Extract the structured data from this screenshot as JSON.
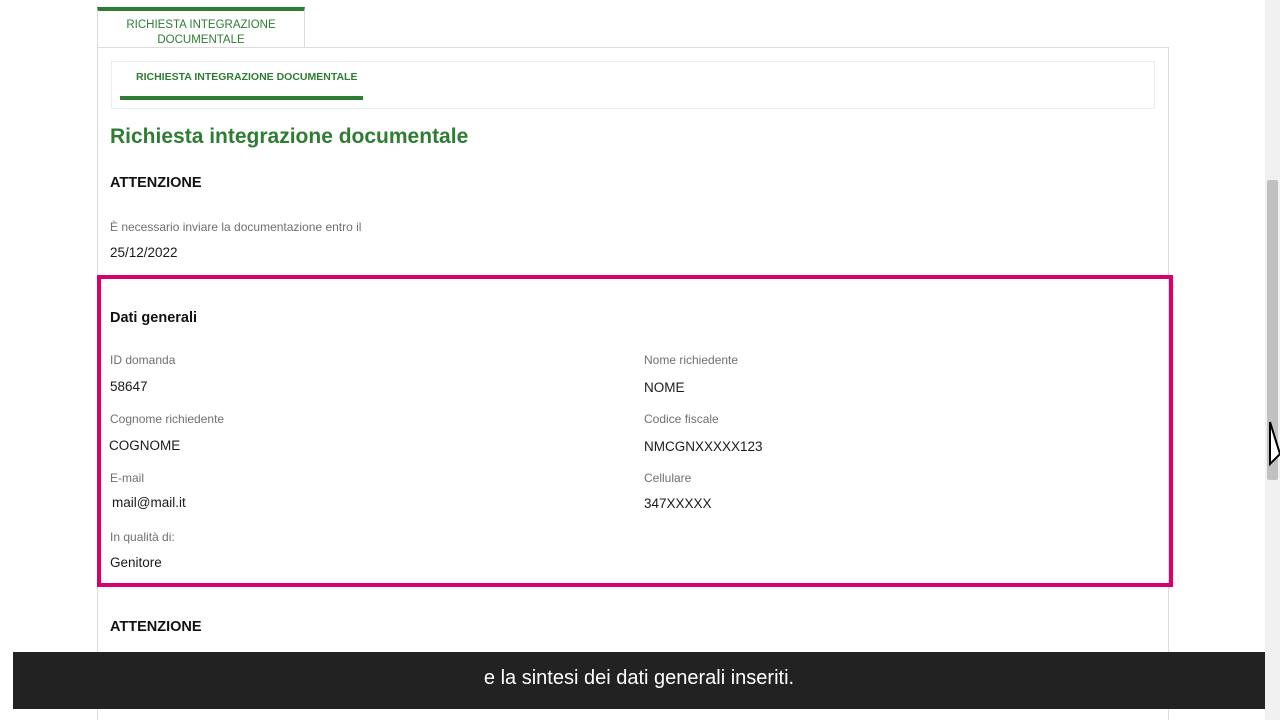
{
  "tabs": {
    "outer_label": "RICHIESTA INTEGRAZIONE DOCUMENTALE",
    "inner_label": "RICHIESTA INTEGRAZIONE DOCUMENTALE"
  },
  "page_title": "Richiesta integrazione documentale",
  "attention_1": {
    "heading": "ATTENZIONE",
    "deadline_label": "È necessario inviare la documentazione entro il",
    "deadline_value": "25/12/2022"
  },
  "general_data": {
    "heading": "Dati generali",
    "id_domanda": {
      "label": "ID domanda",
      "value": "58647"
    },
    "nome_richiedente": {
      "label": "Nome richiedente",
      "value": "NOME"
    },
    "cognome_richiedente": {
      "label": "Cognome richiedente",
      "value": "COGNOME"
    },
    "codice_fiscale": {
      "label": "Codice fiscale",
      "value": "NMCGNXXXXX123"
    },
    "email": {
      "label": "E-mail",
      "value": "mail@mail.it"
    },
    "cellulare": {
      "label": "Cellulare",
      "value": "347XXXXX"
    },
    "in_qualita": {
      "label": "In qualità di:",
      "value": "Genitore"
    }
  },
  "attention_2": {
    "heading": "ATTENZIONE"
  },
  "subtitle": "e la sintesi dei dati generali inseriti.",
  "colors": {
    "accent_green": "#2e7d32",
    "highlight_magenta": "#d6006f",
    "subtitle_bg": "#222222"
  },
  "icons": {
    "cursor": "mouse-pointer-icon"
  }
}
